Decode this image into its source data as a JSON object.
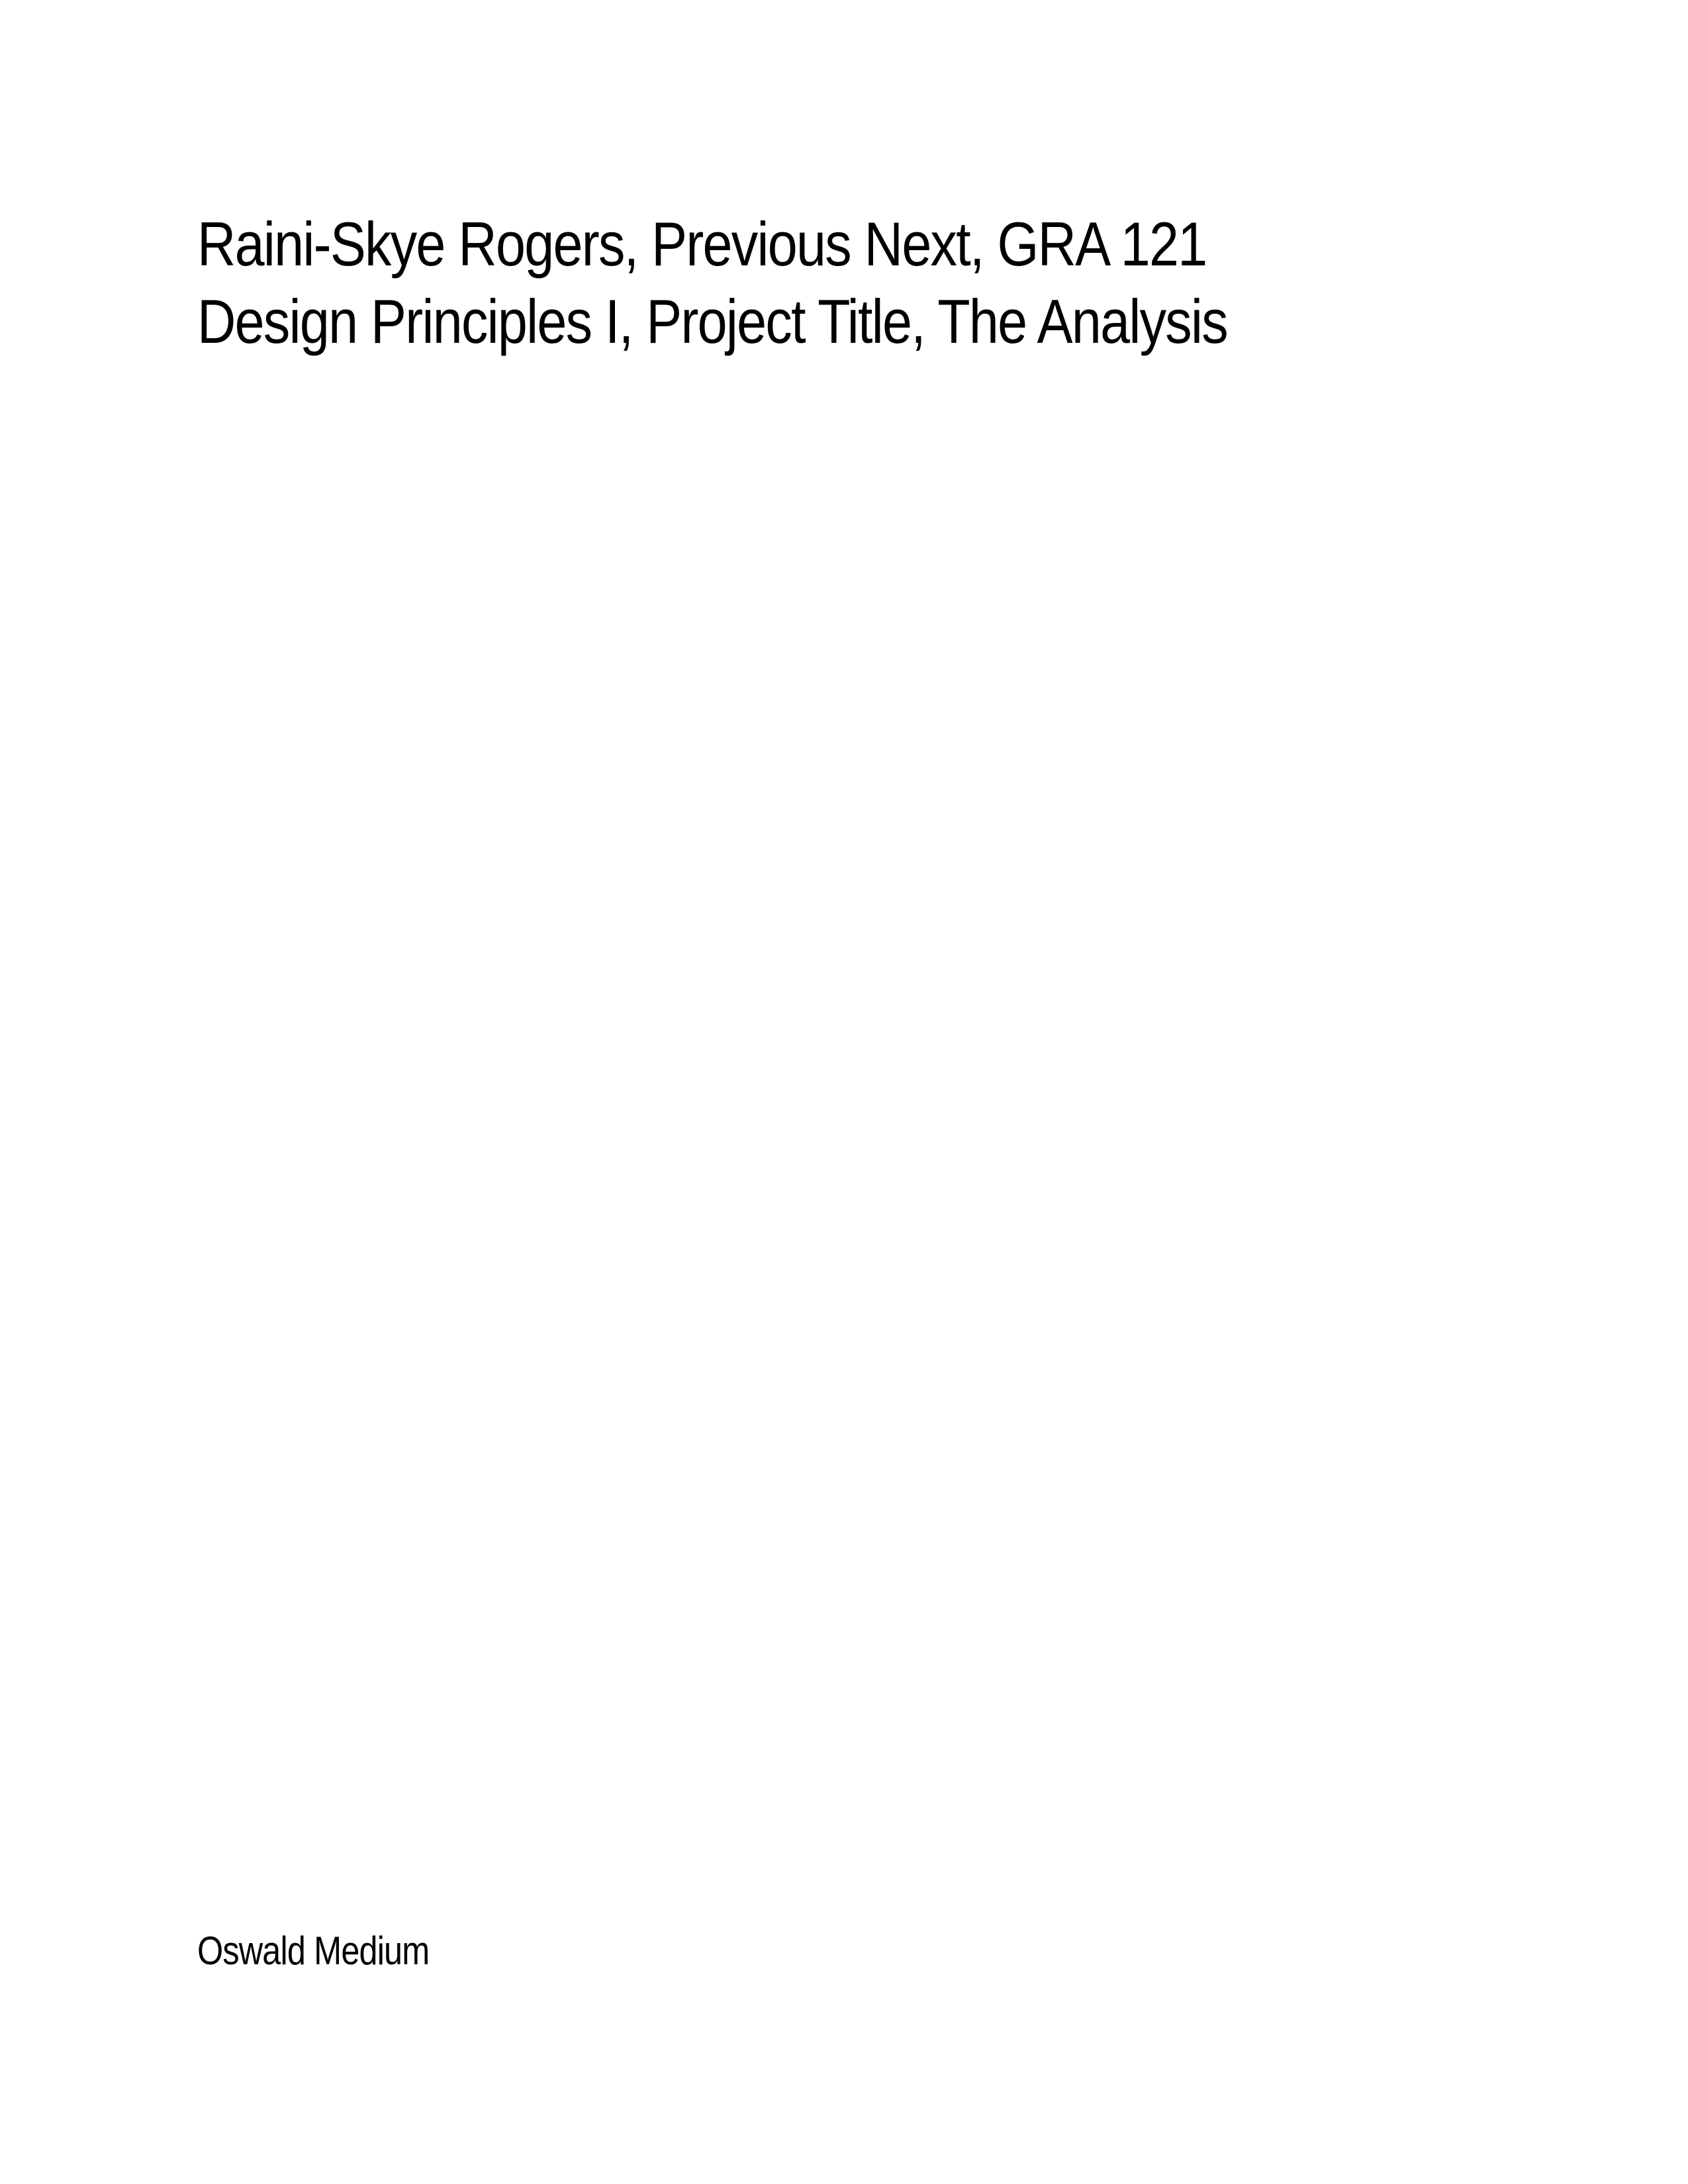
{
  "specimen": {
    "line1": "Raini-Skye Rogers, Previous Next, GRA 121",
    "line2": "Design Principles I, Project Title, The Analysis"
  },
  "footer": {
    "font_name": "Oswald Medium"
  },
  "colors": {
    "background": "#ffffff",
    "text": "#000000"
  }
}
